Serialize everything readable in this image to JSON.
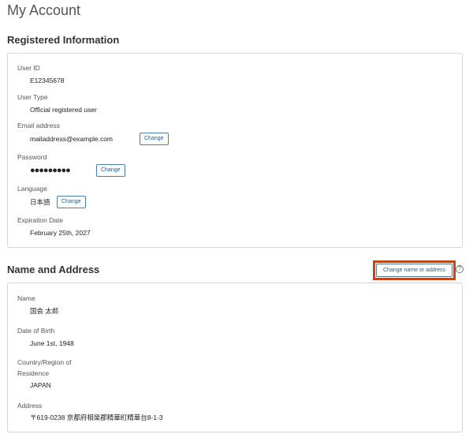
{
  "page": {
    "title": "My Account"
  },
  "registered": {
    "section_title": "Registered Information",
    "user_id": {
      "label": "User ID",
      "value": "E12345678"
    },
    "user_type": {
      "label": "User Type",
      "value": "Official registered user"
    },
    "email": {
      "label": "Email address",
      "value": "mailaddress@example.com",
      "button": "Change"
    },
    "password": {
      "label": "Password",
      "value": "●●●●●●●●●",
      "button": "Change"
    },
    "language": {
      "label": "Language",
      "value": "日本語",
      "button": "Change"
    },
    "expiration": {
      "label": "Expiration Date",
      "value": "February 25th, 2027"
    }
  },
  "name_address": {
    "section_title": "Name and Address",
    "change_button": "Change name or address",
    "help_icon": "?",
    "name": {
      "label": "Name",
      "value": "国会 太郎"
    },
    "birth": {
      "label": "Date of Birth",
      "value": "June 1st, 1948"
    },
    "country": {
      "label_line1": "Country/Region of",
      "label_line2": "Residence",
      "value": "JAPAN"
    },
    "address": {
      "label": "Address",
      "value": "〒619-0238 京都府相楽郡精華町精華台8-1-3"
    }
  },
  "colors": {
    "highlight": "#c0461d",
    "button_border": "#4a7fa8",
    "card_border": "#d6d6d6"
  }
}
